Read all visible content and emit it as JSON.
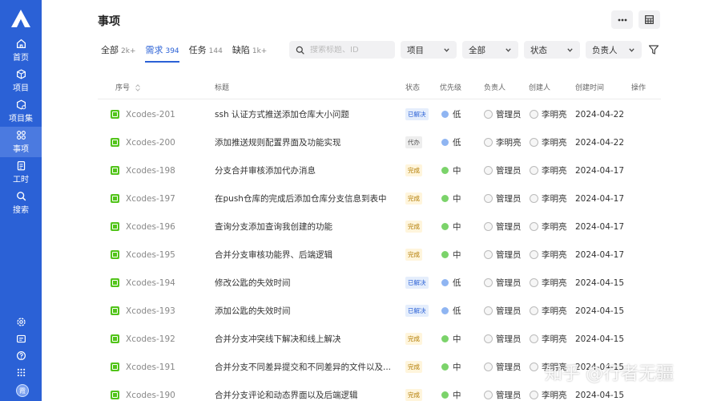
{
  "sidebar": {
    "items": [
      {
        "label": "首页",
        "icon": "home-icon"
      },
      {
        "label": "项目",
        "icon": "cube-icon"
      },
      {
        "label": "项目集",
        "icon": "cube-set-icon"
      },
      {
        "label": "事项",
        "icon": "grid-icon",
        "active": true
      },
      {
        "label": "工时",
        "icon": "clipboard-icon"
      },
      {
        "label": "搜索",
        "icon": "search-icon"
      }
    ],
    "bottom_icons": [
      "settings-icon",
      "message-icon",
      "help-icon",
      "apps-icon"
    ],
    "avatar_text": "霞"
  },
  "header": {
    "title": "事项"
  },
  "tabs": [
    {
      "label": "全部",
      "count": "2k+"
    },
    {
      "label": "需求",
      "count": "394",
      "active": true
    },
    {
      "label": "任务",
      "count": "144"
    },
    {
      "label": "缺陷",
      "count": "1k+"
    }
  ],
  "filters": {
    "search_placeholder": "搜索标题、ID",
    "project": "项目",
    "scope": "全部",
    "status": "状态",
    "assignee": "负责人"
  },
  "table": {
    "headers": {
      "seq": "序号",
      "title": "标题",
      "status": "状态",
      "priority": "优先级",
      "assignee": "负责人",
      "creator": "创建人",
      "created_at": "创建时间",
      "actions": "操作"
    },
    "rows": [
      {
        "id": "Xcodes-201",
        "title": "ssh 认证方式推送添加仓库大小问题",
        "status": "已解决",
        "priority": "低",
        "assignee": "管理员",
        "creator": "李明亮",
        "date": "2024-04-22"
      },
      {
        "id": "Xcodes-200",
        "title": "添加推送规则配置界面及功能实现",
        "status": "代办",
        "priority": "低",
        "assignee": "李明亮",
        "creator": "李明亮",
        "date": "2024-04-22"
      },
      {
        "id": "Xcodes-198",
        "title": "分支合并审核添加代办消息",
        "status": "完成",
        "priority": "中",
        "assignee": "管理员",
        "creator": "李明亮",
        "date": "2024-04-17"
      },
      {
        "id": "Xcodes-197",
        "title": "在push仓库的完成后添加仓库分支信息到表中",
        "status": "完成",
        "priority": "中",
        "assignee": "管理员",
        "creator": "李明亮",
        "date": "2024-04-17"
      },
      {
        "id": "Xcodes-196",
        "title": "查询分支添加查询我创建的功能",
        "status": "完成",
        "priority": "中",
        "assignee": "管理员",
        "creator": "李明亮",
        "date": "2024-04-17"
      },
      {
        "id": "Xcodes-195",
        "title": "合并分支审核功能界、后端逻辑",
        "status": "完成",
        "priority": "中",
        "assignee": "管理员",
        "creator": "李明亮",
        "date": "2024-04-17"
      },
      {
        "id": "Xcodes-194",
        "title": "修改公匙的失效时间",
        "status": "已解决",
        "priority": "低",
        "assignee": "管理员",
        "creator": "李明亮",
        "date": "2024-04-15"
      },
      {
        "id": "Xcodes-193",
        "title": "添加公匙的失效时间",
        "status": "已解决",
        "priority": "低",
        "assignee": "管理员",
        "creator": "李明亮",
        "date": "2024-04-15"
      },
      {
        "id": "Xcodes-192",
        "title": "合并分支冲突线下解决和线上解决",
        "status": "完成",
        "priority": "中",
        "assignee": "管理员",
        "creator": "李明亮",
        "date": "2024-04-15"
      },
      {
        "id": "Xcodes-191",
        "title": "合并分支不同差异提交和不同差异的文件以及...",
        "status": "完成",
        "priority": "中",
        "assignee": "管理员",
        "creator": "李明亮",
        "date": "2024-04-15"
      },
      {
        "id": "Xcodes-190",
        "title": "合并分支评论和动态界面以及后端逻辑",
        "status": "完成",
        "priority": "中",
        "assignee": "管理员",
        "creator": "李明亮",
        "date": "2024-04-15"
      }
    ]
  },
  "colors": {
    "sidebar": "#2b61d6",
    "accent": "#2b61d6",
    "priority_low": "#8fb5f2",
    "priority_mid": "#7bd36a",
    "type_icon": "#52c41a"
  },
  "watermark": "知乎 @行者无疆"
}
